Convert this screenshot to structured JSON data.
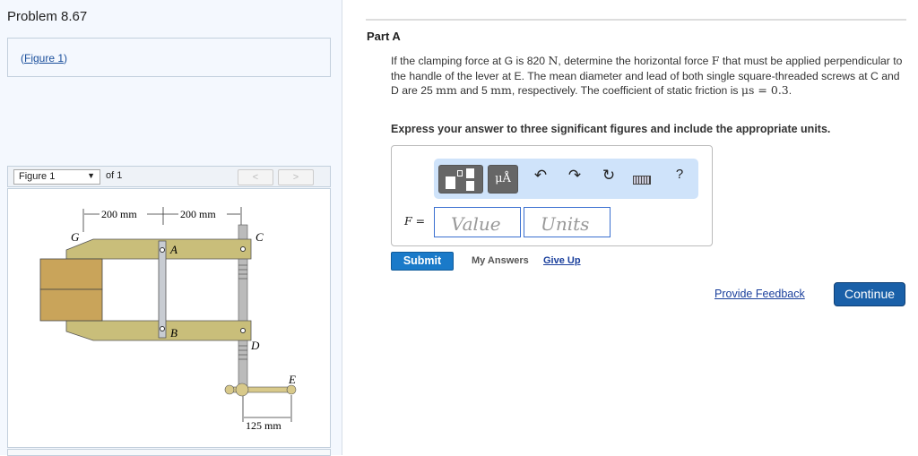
{
  "problem": {
    "title": "Problem 8.67",
    "figure_link_open": "(",
    "figure_link": "Figure 1",
    "figure_link_close": ")"
  },
  "figure_viewer": {
    "selected": "Figure 1",
    "of_label": "of 1",
    "prev": "<",
    "next": ">",
    "labels": {
      "dim1": "200 mm",
      "dim2": "200 mm",
      "dim3": "125 mm",
      "G": "G",
      "A": "A",
      "B": "B",
      "C": "C",
      "D": "D",
      "E": "E"
    }
  },
  "part": {
    "title": "Part A",
    "question": [
      {
        "t": "If the clamping force at G is 820 "
      },
      {
        "m": "N"
      },
      {
        "t": ", determine the horizontal force "
      },
      {
        "m": "F"
      },
      {
        "t": " that must be applied perpendicular to the handle of the lever at E. The mean diameter and lead of both single square-threaded screws at C and D are 25 "
      },
      {
        "m": "mm"
      },
      {
        "t": " and 5 "
      },
      {
        "m": "mm"
      },
      {
        "t": ", respectively. The coefficient of static friction is "
      },
      {
        "m": "μs = 0.3"
      },
      {
        "t": "."
      }
    ],
    "instruction": "Express your answer to three significant figures and include the appropriate units."
  },
  "answer": {
    "label": "F =",
    "value_placeholder": "Value",
    "units_placeholder": "Units",
    "toolbar": {
      "units_btn": "μÅ",
      "undo": "↶",
      "redo": "↷",
      "reset": "↻",
      "help": "?"
    }
  },
  "actions": {
    "submit": "Submit",
    "my_answers": "My Answers",
    "give_up": "Give Up",
    "feedback": "Provide Feedback",
    "continue": "Continue"
  }
}
